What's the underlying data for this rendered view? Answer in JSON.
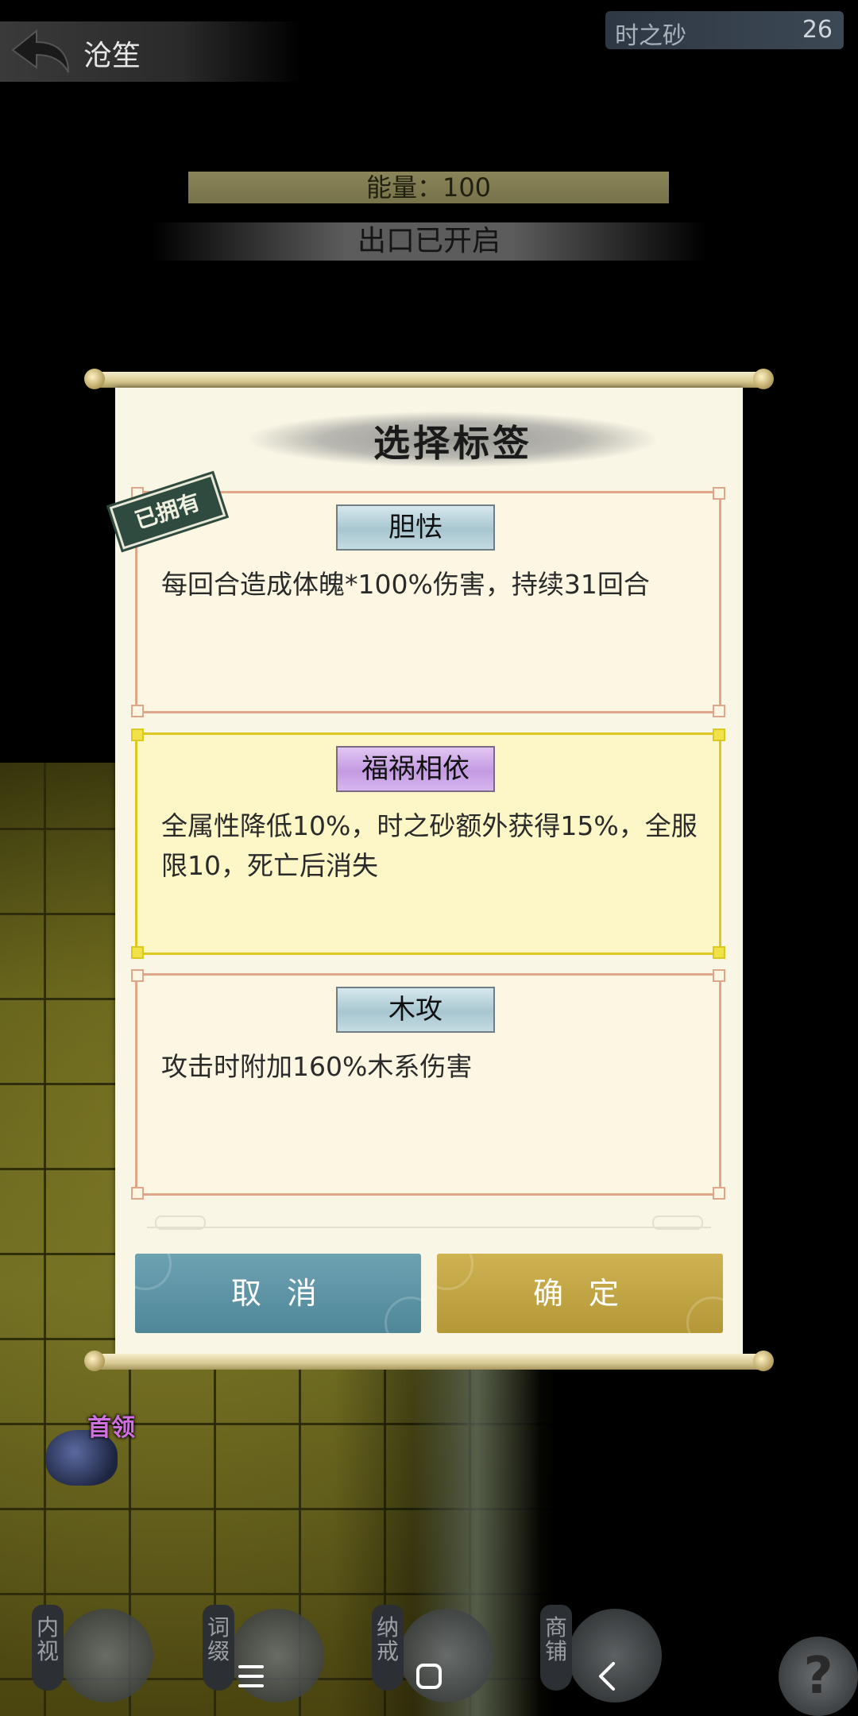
{
  "header": {
    "back_icon": "back-arrow-icon",
    "location": "沧笙",
    "currency": {
      "label": "时之砂",
      "value": "26"
    }
  },
  "status": {
    "energy": "能量：100",
    "exit": "出口已开启"
  },
  "map": {
    "boss_label": "首领"
  },
  "dialog": {
    "title": "选择标签",
    "owned_badge": "已拥有",
    "cards": [
      {
        "name": "胆怯",
        "description": "每回合造成体魄*100%伤害，持续31回合",
        "selected": false,
        "owned": true
      },
      {
        "name": "福祸相依",
        "description": "全属性降低10%，时之砂额外获得15%，全服限10，死亡后消失",
        "selected": true,
        "owned": false
      },
      {
        "name": "木攻",
        "description": "攻击时附加160%木系伤害",
        "selected": false,
        "owned": false
      }
    ],
    "cancel_label": "取 消",
    "confirm_label": "确 定"
  },
  "bottom_menu": [
    {
      "label": "内视",
      "icon": "eye-icon"
    },
    {
      "label": "词缀",
      "icon": "mask-icon"
    },
    {
      "label": "纳戒",
      "icon": "ring-icon"
    },
    {
      "label": "商铺",
      "icon": "shop-icon"
    }
  ],
  "help": {
    "label": "?"
  },
  "colors": {
    "cancel": "#5b93a5",
    "confirm": "#c2a645",
    "selected_border": "#dcc820",
    "card_border": "#e0a68a"
  }
}
